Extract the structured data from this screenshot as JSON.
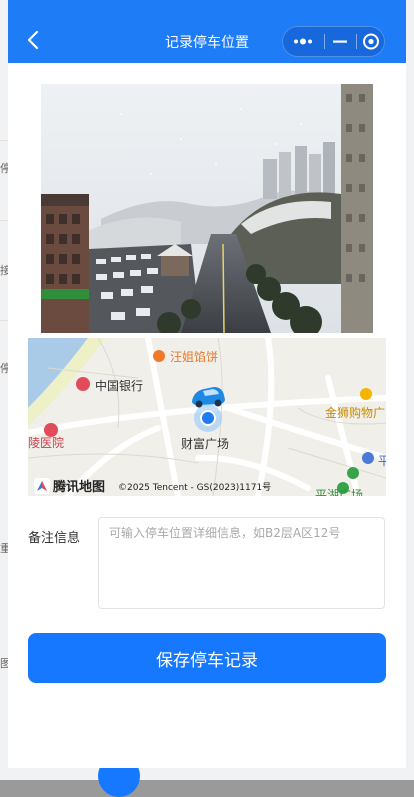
{
  "navbar": {
    "title": "记录停车位置",
    "capsule_icons": [
      "more-dots-icon",
      "minimize-icon",
      "close-circle-icon"
    ]
  },
  "background_page": {
    "visible_chars": [
      "停",
      "接",
      "停",
      "重",
      "图"
    ]
  },
  "map": {
    "labels": {
      "restaurant": "汪姐馅饼",
      "bank": "中国银行",
      "plaza": "财富广场",
      "store": "金狮购物广",
      "hospital": "陵医院",
      "square": "平湖广场",
      "edge_poi": "平"
    },
    "logo_text": "腾讯地图",
    "copyright": "©2025 Tencent - GS(2023)1171号",
    "marker_icon": "car-marker-icon"
  },
  "form": {
    "note_label": "备注信息",
    "note_placeholder": "可输入停车位置详细信息，如B2层A区12号",
    "note_value": ""
  },
  "actions": {
    "save_label": "保存停车记录"
  },
  "colors": {
    "primary": "#1677ff",
    "navbar": "#1e7cf7"
  }
}
